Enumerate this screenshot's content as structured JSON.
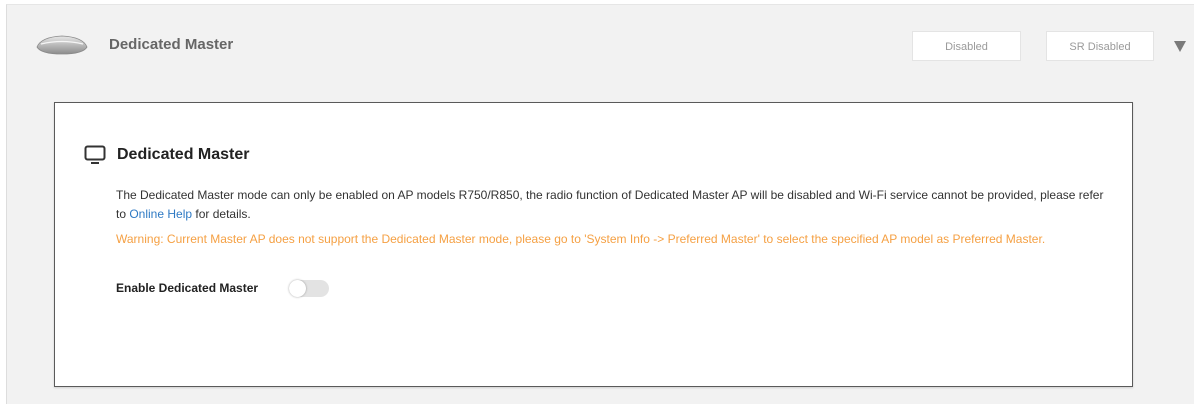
{
  "header": {
    "title": "Dedicated Master",
    "ap_icon": "access-point-icon",
    "badges": [
      "Disabled",
      "SR Disabled"
    ],
    "expand_icon": "chevron-down-icon"
  },
  "card": {
    "icon": "monitor-icon",
    "title": "Dedicated Master",
    "description_before_link": "The Dedicated Master mode can only be enabled on AP models R750/R850, the radio function of Dedicated Master AP will be disabled and Wi-Fi service cannot be provided, please refer to ",
    "help_link": "Online Help",
    "description_after_link": " for details.",
    "warning": "Warning: Current Master AP does not support the Dedicated Master mode, please go to 'System Info -> Preferred Master' to select the specified AP model as Preferred Master.",
    "toggle_label": "Enable Dedicated Master",
    "toggle_enabled": false
  },
  "colors": {
    "link": "#2f7ac4",
    "warning": "#f5a043",
    "panel_background": "#f2f2f2"
  }
}
